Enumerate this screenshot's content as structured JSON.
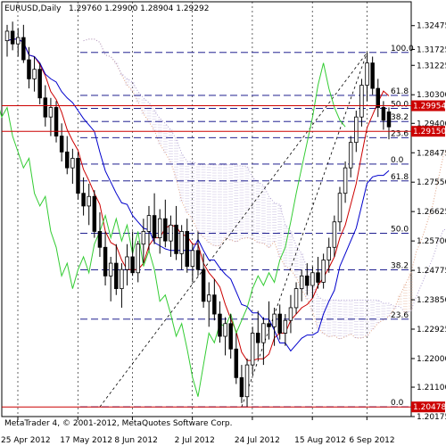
{
  "header": {
    "symbol": "EURUSD,Daily",
    "ohlc": "1.29760 1.29900 1.28904 1.29292"
  },
  "footer": {
    "copyright": "MetaTrader 4, © 2001-2012, MetaQuotes Software Corp."
  },
  "colors": {
    "background": "#ffffff",
    "candle": "#000000",
    "grid": "#000000",
    "price_line_red": "#cc0000",
    "tenkan": "#cc0000",
    "kijun": "#0000cc",
    "chikou": "#33cc33",
    "span_a": "#e0a080",
    "span_b": "#b0a0d0",
    "fibo": "#000080"
  },
  "chart_data": {
    "type": "candlestick",
    "indicators": [
      "Ichimoku Kinko Hyo",
      "Fibonacci retracement"
    ],
    "grid": true,
    "ylim": [
      1.20175,
      1.33225
    ],
    "y_ticks": [
      "1.32475",
      "1.31725",
      "1.31225",
      "1.30300",
      "1.29400",
      "1.28475",
      "1.27550",
      "1.26625",
      "1.25700",
      "1.24775",
      "1.23850",
      "1.22925",
      "1.22000",
      "1.21100",
      "1.20175"
    ],
    "x_ticks": [
      "25 Apr 2012",
      "17 May 2012",
      "8 Jun 2012",
      "2 Jul 2012",
      "24 Jul 2012",
      "15 Aug 2012",
      "6 Sep 2012"
    ],
    "price_labels": [
      {
        "value": 1.29954,
        "text": "1.29954"
      },
      {
        "value": 1.2915,
        "text": "1.29150"
      },
      {
        "value": 1.20478,
        "text": "1.20478"
      }
    ],
    "fibo_levels": [
      {
        "label": "100.0",
        "value": 1.3163
      },
      {
        "label": "61.8",
        "value": 1.3028
      },
      {
        "label": "50.0",
        "value": 1.2987
      },
      {
        "label": "38.2",
        "value": 1.2946
      },
      {
        "label": "23.6",
        "value": 1.2895
      },
      {
        "label": "0.0",
        "value": 1.2812
      },
      {
        "label": "61.8",
        "value": 1.2759
      },
      {
        "label": "50.0",
        "value": 1.2594
      },
      {
        "label": "38.2",
        "value": 1.2479
      },
      {
        "label": "23.6",
        "value": 1.2324
      },
      {
        "label": "0.0",
        "value": 1.2048
      }
    ],
    "candles": [
      [
        1.32,
        1.325,
        1.315,
        1.323
      ],
      [
        1.323,
        1.326,
        1.317,
        1.319
      ],
      [
        1.319,
        1.324,
        1.315,
        1.321
      ],
      [
        1.321,
        1.325,
        1.313,
        1.314
      ],
      [
        1.314,
        1.318,
        1.305,
        1.308
      ],
      [
        1.308,
        1.315,
        1.304,
        1.311
      ],
      [
        1.311,
        1.313,
        1.3,
        1.302
      ],
      [
        1.302,
        1.306,
        1.293,
        1.296
      ],
      [
        1.296,
        1.302,
        1.29,
        1.299
      ],
      [
        1.299,
        1.301,
        1.288,
        1.29
      ],
      [
        1.29,
        1.294,
        1.282,
        1.285
      ],
      [
        1.285,
        1.29,
        1.278,
        1.28
      ],
      [
        1.28,
        1.286,
        1.275,
        1.283
      ],
      [
        1.283,
        1.285,
        1.27,
        1.272
      ],
      [
        1.272,
        1.277,
        1.265,
        1.268
      ],
      [
        1.268,
        1.275,
        1.262,
        1.271
      ],
      [
        1.271,
        1.273,
        1.258,
        1.26
      ],
      [
        1.26,
        1.266,
        1.252,
        1.255
      ],
      [
        1.255,
        1.26,
        1.243,
        1.246
      ],
      [
        1.246,
        1.252,
        1.238,
        1.25
      ],
      [
        1.25,
        1.256,
        1.24,
        1.242
      ],
      [
        1.242,
        1.25,
        1.236,
        1.248
      ],
      [
        1.248,
        1.256,
        1.243,
        1.252
      ],
      [
        1.252,
        1.26,
        1.246,
        1.247
      ],
      [
        1.247,
        1.257,
        1.244,
        1.256
      ],
      [
        1.256,
        1.264,
        1.25,
        1.26
      ],
      [
        1.26,
        1.268,
        1.254,
        1.265
      ],
      [
        1.265,
        1.272,
        1.256,
        1.258
      ],
      [
        1.258,
        1.267,
        1.253,
        1.264
      ],
      [
        1.264,
        1.27,
        1.255,
        1.257
      ],
      [
        1.257,
        1.265,
        1.252,
        1.262
      ],
      [
        1.262,
        1.268,
        1.251,
        1.253
      ],
      [
        1.253,
        1.262,
        1.248,
        1.26
      ],
      [
        1.26,
        1.264,
        1.247,
        1.249
      ],
      [
        1.249,
        1.256,
        1.244,
        1.254
      ],
      [
        1.254,
        1.26,
        1.246,
        1.248
      ],
      [
        1.248,
        1.253,
        1.236,
        1.238
      ],
      [
        1.238,
        1.244,
        1.23,
        1.24
      ],
      [
        1.24,
        1.245,
        1.232,
        1.234
      ],
      [
        1.234,
        1.238,
        1.225,
        1.227
      ],
      [
        1.227,
        1.233,
        1.221,
        1.231
      ],
      [
        1.231,
        1.234,
        1.22,
        1.223
      ],
      [
        1.223,
        1.228,
        1.212,
        1.214
      ],
      [
        1.214,
        1.218,
        1.206,
        1.208
      ],
      [
        1.208,
        1.22,
        1.2048,
        1.218
      ],
      [
        1.218,
        1.23,
        1.215,
        1.228
      ],
      [
        1.228,
        1.235,
        1.22,
        1.225
      ],
      [
        1.225,
        1.233,
        1.218,
        1.231
      ],
      [
        1.231,
        1.238,
        1.226,
        1.23
      ],
      [
        1.23,
        1.236,
        1.224,
        1.234
      ],
      [
        1.234,
        1.237,
        1.226,
        1.228
      ],
      [
        1.228,
        1.234,
        1.224,
        1.232
      ],
      [
        1.232,
        1.24,
        1.228,
        1.236
      ],
      [
        1.236,
        1.244,
        1.234,
        1.242
      ],
      [
        1.242,
        1.248,
        1.238,
        1.246
      ],
      [
        1.246,
        1.25,
        1.24,
        1.243
      ],
      [
        1.243,
        1.249,
        1.239,
        1.247
      ],
      [
        1.247,
        1.252,
        1.242,
        1.244
      ],
      [
        1.244,
        1.253,
        1.242,
        1.251
      ],
      [
        1.251,
        1.258,
        1.247,
        1.255
      ],
      [
        1.255,
        1.265,
        1.252,
        1.263
      ],
      [
        1.263,
        1.274,
        1.26,
        1.272
      ],
      [
        1.272,
        1.282,
        1.269,
        1.28
      ],
      [
        1.28,
        1.29,
        1.277,
        1.288
      ],
      [
        1.288,
        1.298,
        1.285,
        1.296
      ],
      [
        1.296,
        1.308,
        1.293,
        1.306
      ],
      [
        1.306,
        1.3163,
        1.301,
        1.313
      ],
      [
        1.313,
        1.315,
        1.303,
        1.305
      ],
      [
        1.305,
        1.308,
        1.296,
        1.299
      ],
      [
        1.299,
        1.301,
        1.292,
        1.295
      ],
      [
        1.2976,
        1.299,
        1.289,
        1.2929
      ]
    ]
  }
}
